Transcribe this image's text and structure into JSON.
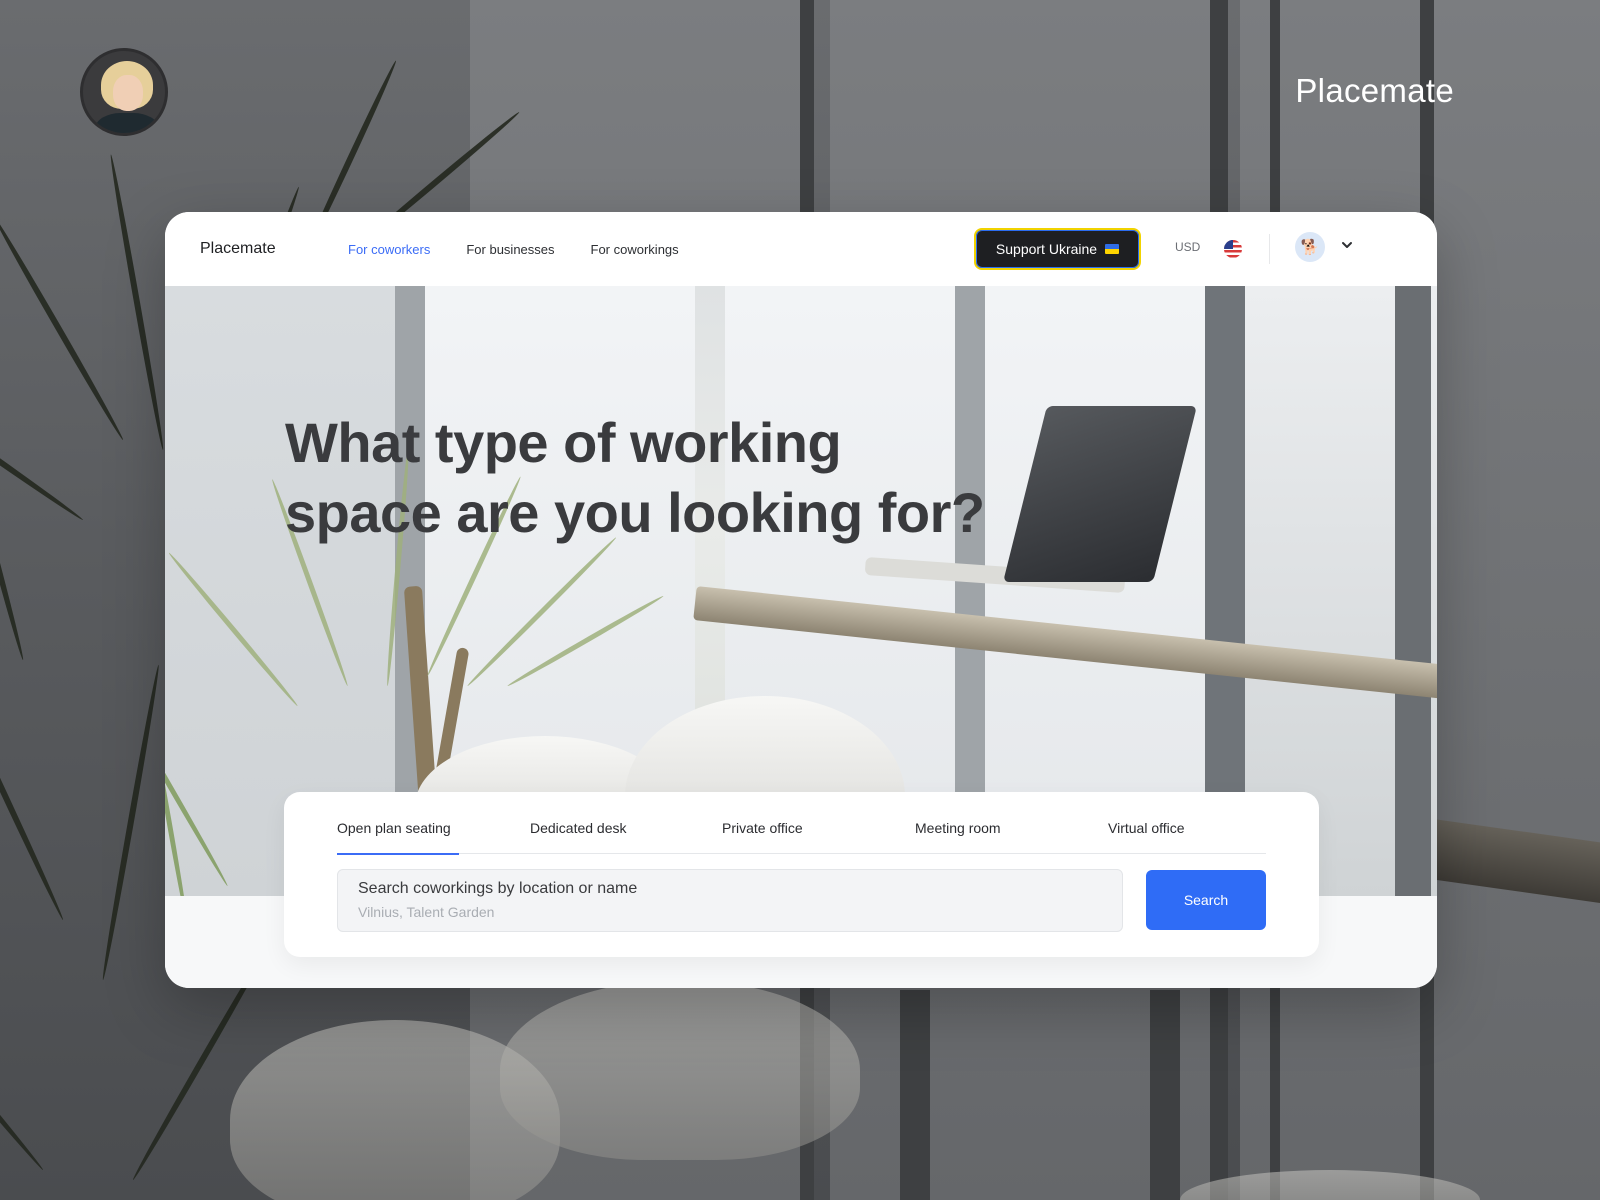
{
  "showcase": {
    "brand_name": "Placemate"
  },
  "nav": {
    "logo": "Placemate",
    "links": [
      {
        "label": "For coworkers",
        "active": true
      },
      {
        "label": "For businesses",
        "active": false
      },
      {
        "label": "For coworkings",
        "active": false
      }
    ],
    "support_button": "Support Ukraine",
    "support_icon": "ukraine-flag-icon",
    "currency": "USD",
    "language_icon": "us-flag-icon",
    "user_icon": "corgi-avatar-icon",
    "menu_icon": "chevron-down-icon"
  },
  "hero": {
    "headline_line1": "What type of working",
    "headline_line2": "space are you looking for?"
  },
  "search": {
    "tabs": [
      {
        "label": "Open plan seating",
        "active": true
      },
      {
        "label": "Dedicated desk",
        "active": false
      },
      {
        "label": "Private office",
        "active": false
      },
      {
        "label": "Meeting room",
        "active": false
      },
      {
        "label": "Virtual office",
        "active": false
      }
    ],
    "field_label": "Search coworkings by location or name",
    "placeholder": "Vilnius, Talent Garden",
    "button_label": "Search"
  },
  "colors": {
    "accent": "#2f6cf6",
    "active_link": "#3b6cf6",
    "support_button_bg": "#1e1f22",
    "support_button_border": "#f1d300"
  }
}
